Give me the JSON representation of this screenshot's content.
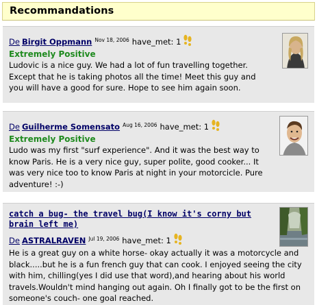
{
  "header": {
    "title": "Recommandations"
  },
  "references": [
    {
      "de": "De",
      "name": "Birgit Oppmann",
      "date": "Nov 18, 2006",
      "have_met": "have_met: 1",
      "rating": "Extremely Positive",
      "text": "Ludovic is a nice guy. We had a lot of fun travelling together. Except that he is taking photos all the time! Meet this guy and you will have a good for sure. Hope to see him again soon.",
      "icon": "shoes-icon",
      "photo": "avatar-photo"
    },
    {
      "de": "De",
      "name": "Guilherme Somensato",
      "date": "Aug 16, 2006",
      "have_met": "have_met: 1",
      "rating": "Extremely Positive",
      "text": "Ludo was my first \"surf experience\". And it was the best way to know Paris. He is a very nice guy, super polite, good cooker... It was very nice too to know Paris at night in your motorcicle. Pure adventure! :-)",
      "icon": "shoes-icon",
      "photo": "avatar-photo"
    },
    {
      "title": "catch a bug- the travel bug(I know it's corny but brain left me)",
      "de": "De",
      "name": "ASTRALRAVEN",
      "date": "Jul 19, 2006",
      "have_met": "have_met: 1",
      "text": "He is a great guy on a white horse- okay actually it was a motorcycle and black.....but he is a fun french guy that can cook. I enjoyed seeing the city with him, chilling(yes I did use that word),and hearing about his world travels.Wouldn't mind hanging out again. Oh I finally got to be the first on someone's couch- one goal reached.",
      "icon": "shoes-icon",
      "photo": "avatar-photo"
    }
  ],
  "colors": {
    "header_bg": "#ffffcc",
    "card_bg": "#e8e8e8",
    "link": "#000066",
    "positive": "#1f8a1f",
    "shoe": "#e6b422"
  }
}
